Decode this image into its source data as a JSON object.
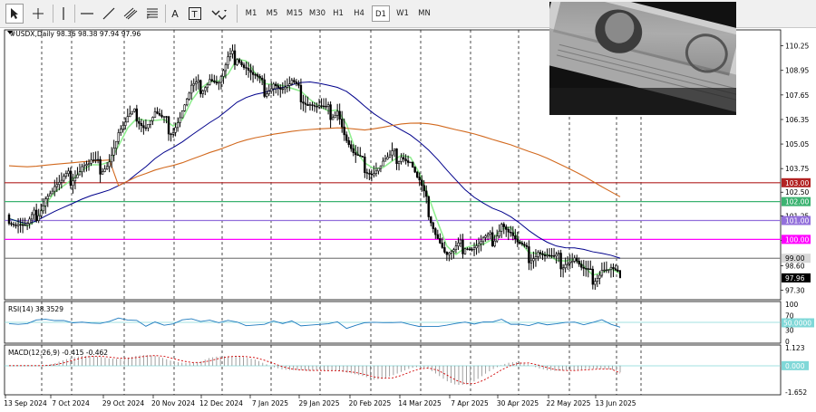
{
  "toolbar": {
    "tools": [
      "cursor-icon",
      "crosshair-icon",
      "vertical-line-icon",
      "horizontal-line-icon",
      "trendline-icon",
      "channel-icon",
      "fibonacci-icon",
      "text-icon",
      "label-icon",
      "shapes-icon"
    ],
    "text_tool": "A",
    "label_tool": "T",
    "timeframes": [
      "M1",
      "M5",
      "M15",
      "M30",
      "H1",
      "H4",
      "D1",
      "W1",
      "MN"
    ],
    "active_timeframe": "D1"
  },
  "chart_data": [
    {
      "type": "candlestick",
      "title": "#USDX,Daily  98.36 98.38 97.94 97.96",
      "symbol": "#USDX",
      "period": "Daily",
      "ohlc": {
        "open": 98.36,
        "high": 98.38,
        "low": 97.94,
        "close": 97.96
      },
      "x_tick_labels": [
        "13 Sep 2024",
        "7 Oct 2024",
        "29 Oct 2024",
        "20 Nov 2024",
        "12 Dec 2024",
        "7 Jan 2025",
        "29 Jan 2025",
        "20 Feb 2025",
        "14 Mar 2025",
        "7 Apr 2025",
        "30 Apr 2025",
        "22 May 2025",
        "13 Jun 2025"
      ],
      "y_tick_labels": [
        "110.25",
        "108.95",
        "107.65",
        "106.35",
        "105.05",
        "103.75",
        "102.50",
        "101.25",
        "99.95",
        "98.60",
        "97.30"
      ],
      "ylim": [
        96.9,
        111.0
      ],
      "horizontal_levels": [
        {
          "label": "103.00",
          "value": 103.0,
          "color": "#b22222"
        },
        {
          "label": "102.00",
          "value": 102.0,
          "color": "#3cb371"
        },
        {
          "label": "101.00",
          "value": 101.0,
          "color": "#9370db"
        },
        {
          "label": "100.00",
          "value": 100.0,
          "color": "#ff00ff"
        },
        {
          "label": "99.00",
          "value": 99.0,
          "color": "#808080"
        }
      ],
      "price_marker": {
        "label": "97.96",
        "value": 97.96
      },
      "close_series": [
        101.1,
        100.8,
        100.6,
        101.4,
        102.3,
        102.7,
        103.0,
        103.4,
        103.9,
        104.0,
        103.9,
        104.3,
        105.6,
        106.2,
        106.6,
        106.0,
        106.6,
        106.1,
        105.9,
        106.8,
        107.9,
        108.1,
        108.6,
        108.2,
        109.3,
        109.8,
        109.1,
        108.5,
        108.0,
        108.4,
        107.9,
        108.1,
        107.6,
        107.2,
        106.9,
        106.7,
        107.0,
        105.2,
        104.2,
        103.9,
        103.6,
        104.0,
        104.3,
        104.6,
        104.1,
        102.9,
        101.6,
        100.2,
        99.1,
        99.3,
        99.8,
        99.6,
        99.9,
        100.1,
        101.0,
        100.3,
        99.5,
        99.1,
        99.4,
        99.0,
        98.8,
        98.9,
        99.0,
        98.2,
        98.0,
        98.5,
        98.4,
        97.96
      ],
      "moving_averages": [
        {
          "color": "#90ee90",
          "role": "fast"
        },
        {
          "color": "#00008b",
          "role": "medium"
        },
        {
          "color": "#d2691e",
          "role": "slow"
        }
      ]
    },
    {
      "type": "line",
      "title": "RSI(14) 38.3529",
      "name": "RSI",
      "period": 14,
      "value": 38.3529,
      "y_tick_labels": [
        "100",
        "70",
        "50.0000",
        "30",
        "0"
      ],
      "level_label": "50.0000",
      "ylim": [
        0,
        100
      ]
    },
    {
      "type": "bar",
      "title": "MACD(12,26,9) -0.415 -0.462",
      "name": "MACD",
      "params": [
        12,
        26,
        9
      ],
      "macd": -0.415,
      "signal": -0.462,
      "y_tick_labels": [
        "1.123",
        "0.000",
        "-1.652"
      ],
      "zero_label": "0.000",
      "ylim": [
        -1.652,
        1.123
      ]
    }
  ]
}
